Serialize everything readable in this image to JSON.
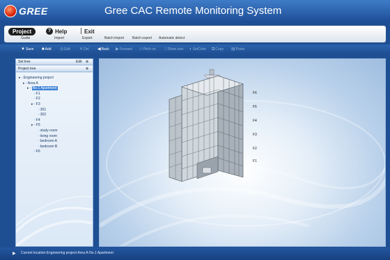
{
  "app": {
    "brand": "GREE",
    "title": "Gree CAC Remote Monitoring System"
  },
  "menu": {
    "project": "Project",
    "help": "Help",
    "exit": "Exit",
    "sub": [
      "Guide",
      "Import",
      "Export",
      "Batch import",
      "Batch export",
      "Automatic detect"
    ]
  },
  "toolbar": [
    {
      "label": "Save",
      "icon": "save-icon",
      "enabled": true
    },
    {
      "label": "Add",
      "icon": "add-icon",
      "enabled": true
    },
    {
      "label": "Edit",
      "icon": "edit-icon",
      "enabled": false
    },
    {
      "label": "Del",
      "icon": "delete-icon",
      "enabled": false
    },
    {
      "label": "Back",
      "icon": "back-icon",
      "enabled": true
    },
    {
      "label": "Forward",
      "icon": "forward-icon",
      "enabled": false
    },
    {
      "label": "Pitch on",
      "icon": "pitch-icon",
      "enabled": false
    },
    {
      "label": "Show size",
      "icon": "size-icon",
      "enabled": false
    },
    {
      "label": "SetColor",
      "icon": "color-icon",
      "enabled": false
    },
    {
      "label": "Copy",
      "icon": "copy-icon",
      "enabled": false
    },
    {
      "label": "Paste",
      "icon": "paste-icon",
      "enabled": false
    }
  ],
  "sidebar": {
    "header1_left": "Set tree",
    "header1_right": "Edit",
    "header2_left": "Project tree",
    "tree": [
      {
        "label": "Engineering project",
        "level": 0,
        "toggle": "-",
        "selected": false
      },
      {
        "label": "Area A",
        "level": 1,
        "toggle": "-",
        "selected": false
      },
      {
        "label": "No.1 Apartment",
        "level": 2,
        "toggle": "-",
        "selected": true
      },
      {
        "label": "F1",
        "level": 3,
        "toggle": "",
        "selected": false
      },
      {
        "label": "F2",
        "level": 3,
        "toggle": "",
        "selected": false
      },
      {
        "label": "F3",
        "level": 3,
        "toggle": "-",
        "selected": false
      },
      {
        "label": "301",
        "level": 4,
        "toggle": "",
        "selected": false
      },
      {
        "label": "302",
        "level": 4,
        "toggle": "",
        "selected": false
      },
      {
        "label": "F4",
        "level": 3,
        "toggle": "",
        "selected": false
      },
      {
        "label": "F5",
        "level": 3,
        "toggle": "-",
        "selected": false
      },
      {
        "label": "study room",
        "level": 4,
        "toggle": "",
        "selected": false
      },
      {
        "label": "living room",
        "level": 4,
        "toggle": "",
        "selected": false
      },
      {
        "label": "bedroom A",
        "level": 4,
        "toggle": "",
        "selected": false
      },
      {
        "label": "bedroom B",
        "level": 4,
        "toggle": "",
        "selected": false
      },
      {
        "label": "F6",
        "level": 3,
        "toggle": "",
        "selected": false
      }
    ]
  },
  "building": {
    "floors": [
      "F6",
      "F5",
      "F4",
      "F3",
      "F2",
      "F1"
    ]
  },
  "status": {
    "text": "Current location:Engineering project-Area A-No.1 Apartment"
  }
}
